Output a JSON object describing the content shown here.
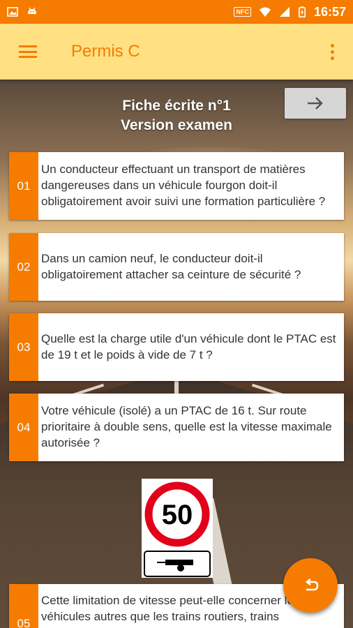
{
  "status_bar": {
    "time": "16:57",
    "nfc_label": "NFC",
    "icons": [
      "image-icon",
      "android-icon",
      "nfc-icon",
      "wifi-icon",
      "signal-icon",
      "battery-charging-icon"
    ]
  },
  "app_bar": {
    "title": "Permis C",
    "menu_icon": "hamburger-icon",
    "more_icon": "more-vert-icon"
  },
  "fiche": {
    "title_line1": "Fiche écrite n°1",
    "title_line2": "Version examen",
    "next_icon": "arrow-right-icon"
  },
  "questions": [
    {
      "number": "01",
      "text": "Un conducteur effectuant un transport de matières dangereuses dans un véhicule fourgon doit-il obligatoirement avoir suivi une formation particulière ?"
    },
    {
      "number": "02",
      "text": "Dans un camion neuf, le conducteur doit-il obligatoirement attacher sa ceinture de sécurité ?"
    },
    {
      "number": "03",
      "text": "Quelle est la charge utile d'un véhicule dont le PTAC est de 19 t et le poids à vide de 7 t ?"
    },
    {
      "number": "04",
      "text": "Votre véhicule (isolé) a un PTAC de 16 t. Sur route prioritaire à double sens, quelle est la vitesse maximale autorisée ?"
    },
    {
      "number": "05",
      "text": "Cette limitation de vitesse peut-elle concerner les véhicules autres que les trains routiers, trains"
    }
  ],
  "sign": {
    "speed": "50",
    "icon": "speed-limit-trailer-sign"
  },
  "fab": {
    "icon": "undo-icon"
  },
  "colors": {
    "accent": "#f57c00",
    "app_bar_bg": "#ffe082",
    "next_button_bg": "#d6d6d6"
  }
}
